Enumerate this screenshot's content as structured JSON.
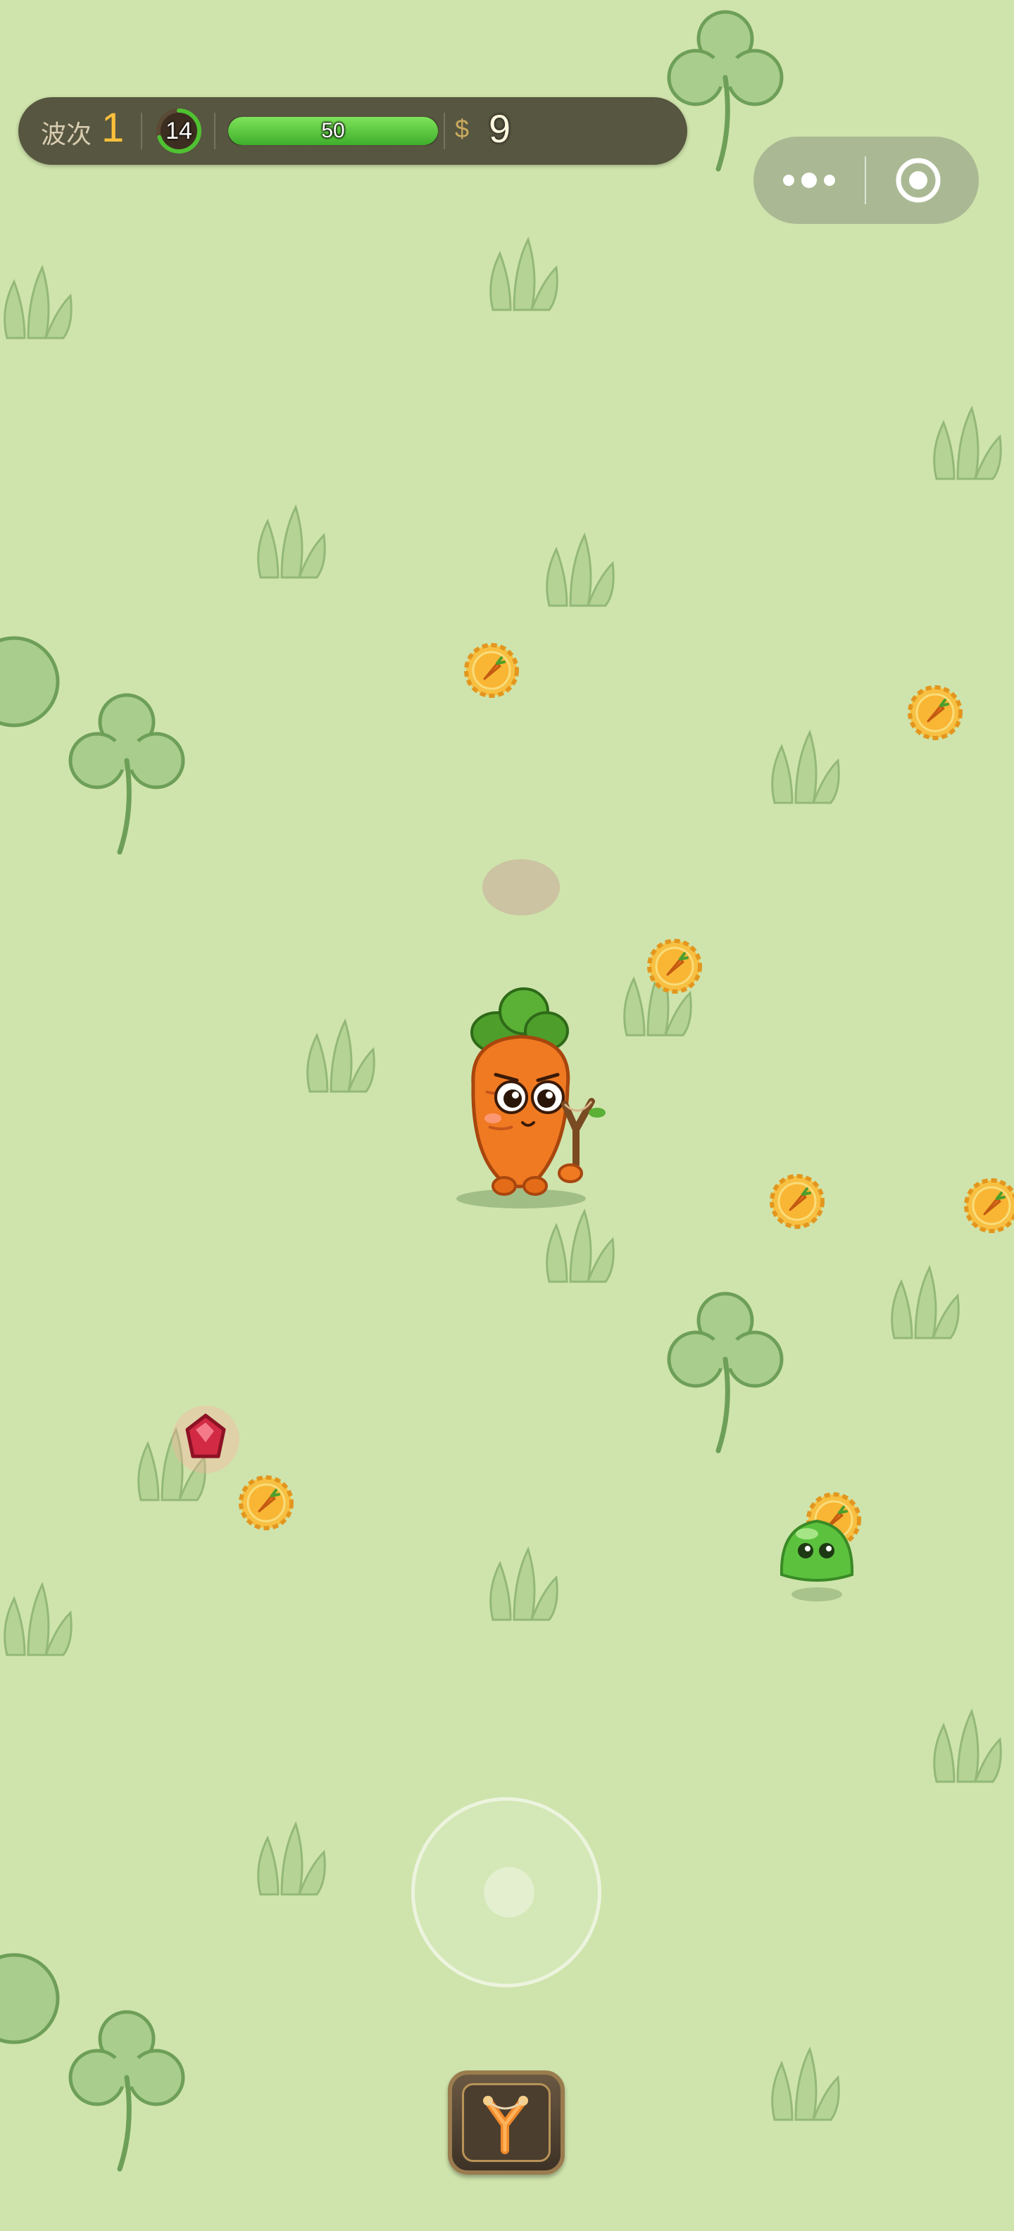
{
  "hud": {
    "wave_label": "波次",
    "wave_value": "1",
    "timer_value": "14",
    "timer_progress": 0.7,
    "hp_value": "50",
    "hp_fill": 1.0,
    "money_sign": "$",
    "money_value": "9"
  },
  "capsule": {
    "more_icon": "more-dots-icon",
    "close_icon": "target-close-icon"
  },
  "scene": {
    "player": "carrot-with-slingshot",
    "enemy": "green-slime",
    "pickups": [
      "carrot-coin",
      "red-gem"
    ],
    "colors": {
      "ground": "#cfe4ac",
      "coin": "#f4a82a",
      "slime": "#5cc23e",
      "carrot": "#f07a22",
      "gem": "#d22a44"
    }
  },
  "controls": {
    "joystick": "virtual-joystick",
    "weapon_icon": "slingshot-icon"
  }
}
